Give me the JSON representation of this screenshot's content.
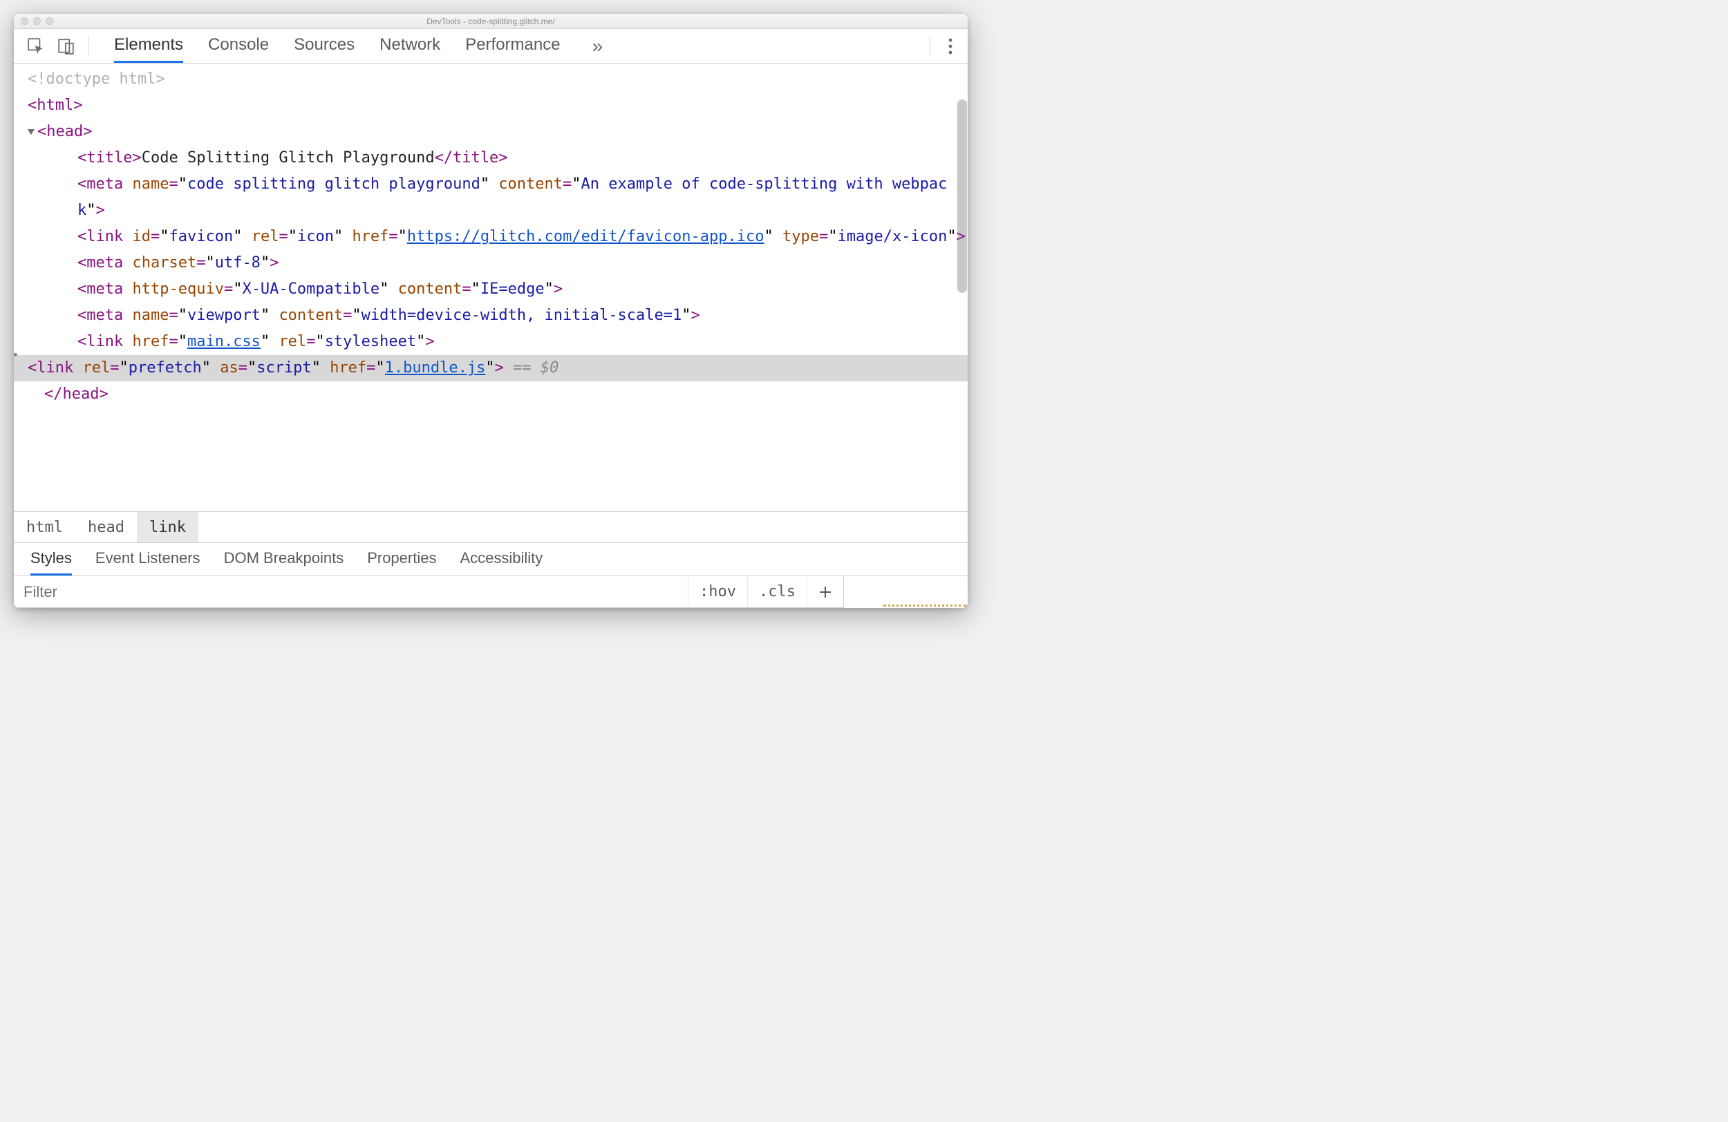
{
  "window": {
    "title": "DevTools - code-splitting.glitch.me/"
  },
  "toolbar": {
    "tabs": [
      "Elements",
      "Console",
      "Sources",
      "Network",
      "Performance"
    ],
    "active_tab_index": 0
  },
  "dom": {
    "doctype": "<!doctype html>",
    "lines": [
      {
        "type": "open",
        "indent": 0,
        "tag": "html"
      },
      {
        "type": "open_disclosed",
        "indent": 0,
        "tag": "head"
      },
      {
        "type": "title",
        "indent": 2,
        "tag": "title",
        "text": "Code Splitting Glitch Playground"
      },
      {
        "type": "meta",
        "indent": 2,
        "tag": "meta",
        "attrs": [
          [
            "name",
            "code splitting glitch playground"
          ],
          [
            "content",
            "An example of code-splitting with webpack"
          ]
        ]
      },
      {
        "type": "link_icon",
        "indent": 2,
        "tag": "link",
        "attrs": [
          [
            "id",
            "favicon"
          ],
          [
            "rel",
            "icon"
          ],
          [
            "href",
            "https://glitch.com/edit/favicon-app.ico"
          ],
          [
            "type",
            "image/x-icon"
          ]
        ],
        "href_is_link": true
      },
      {
        "type": "meta",
        "indent": 2,
        "tag": "meta",
        "attrs": [
          [
            "charset",
            "utf-8"
          ]
        ]
      },
      {
        "type": "meta",
        "indent": 2,
        "tag": "meta",
        "attrs": [
          [
            "http-equiv",
            "X-UA-Compatible"
          ],
          [
            "content",
            "IE=edge"
          ]
        ]
      },
      {
        "type": "meta",
        "indent": 2,
        "tag": "meta",
        "attrs": [
          [
            "name",
            "viewport"
          ],
          [
            "content",
            "width=device-width, initial-scale=1"
          ]
        ]
      },
      {
        "type": "link_css",
        "indent": 2,
        "tag": "link",
        "attrs": [
          [
            "href",
            "main.css"
          ],
          [
            "rel",
            "stylesheet"
          ]
        ],
        "href_is_link": true
      },
      {
        "type": "link_prefetch",
        "indent": 2,
        "tag": "link",
        "attrs": [
          [
            "rel",
            "prefetch"
          ],
          [
            "as",
            "script"
          ],
          [
            "href",
            "1.bundle.js"
          ]
        ],
        "selected": true,
        "href_is_link": true,
        "eq": "== $0"
      },
      {
        "type": "close",
        "indent": 1,
        "tag": "head"
      }
    ]
  },
  "breadcrumb": {
    "items": [
      "html",
      "head",
      "link"
    ],
    "selected_index": 2
  },
  "sub_panel": {
    "tabs": [
      "Styles",
      "Event Listeners",
      "DOM Breakpoints",
      "Properties",
      "Accessibility"
    ],
    "active_index": 0,
    "filter_placeholder": "Filter",
    "hov": ":hov",
    "cls": ".cls"
  }
}
